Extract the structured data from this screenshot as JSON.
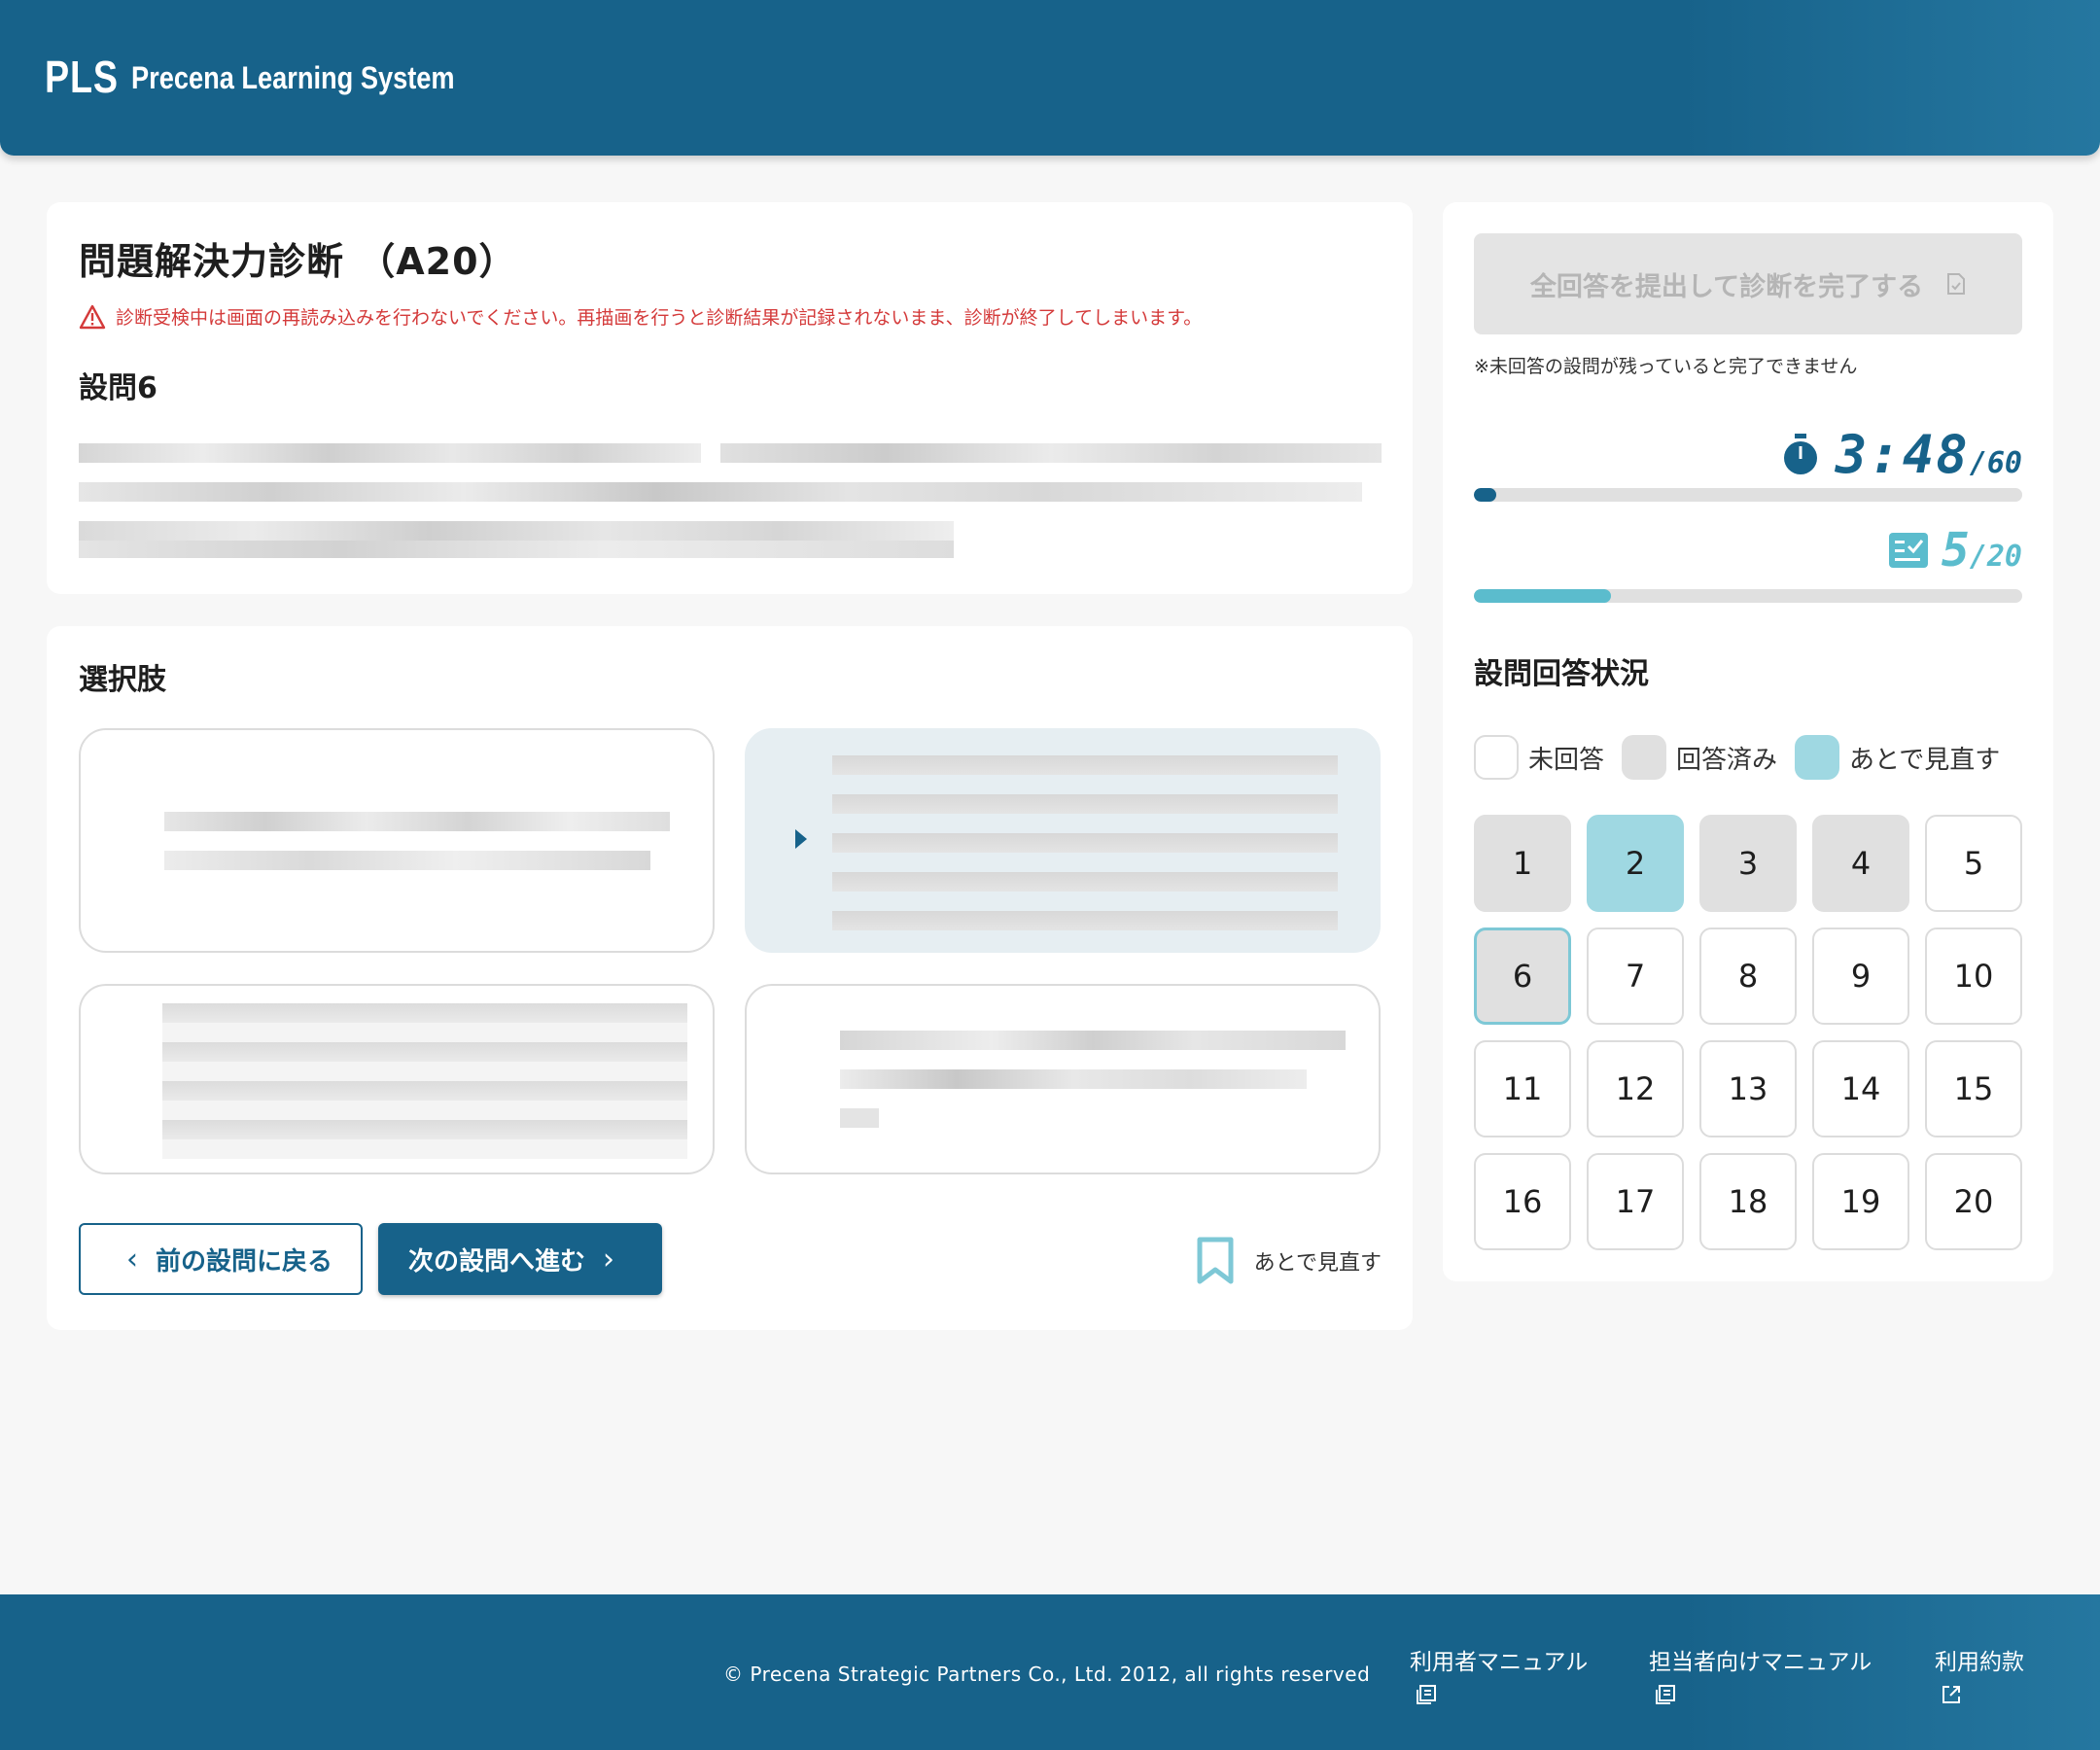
{
  "header": {
    "logo_mark": "PLS",
    "logo_text": "Precena Learning System"
  },
  "question_card": {
    "title": "問題解決力診断 （A20）",
    "warning": "診断受検中は画面の再読み込みを行わないでください。再描画を行うと診断結果が記録されないまま、診断が終了してしまいます。",
    "question_label": "設問6"
  },
  "options_card": {
    "section_label": "選択肢",
    "prev_button": "前の設問に戻る",
    "next_button": "次の設問へ進む",
    "review_later": "あとで見直す"
  },
  "sidebar": {
    "submit_button": "全回答を提出して診断を完了する",
    "submit_note": "※未回答の設問が残っていると完了できません",
    "timer_value": "3:48",
    "timer_total": "/60",
    "timer_progress": 0.04,
    "answered_count": "5",
    "answered_total": "/20",
    "answered_progress": 0.25,
    "status_title": "設問回答状況",
    "legend": {
      "unanswered": "未回答",
      "answered": "回答済み",
      "review": "あとで見直す"
    },
    "questions": [
      {
        "n": "1",
        "state": "answered"
      },
      {
        "n": "2",
        "state": "review"
      },
      {
        "n": "3",
        "state": "answered"
      },
      {
        "n": "4",
        "state": "answered"
      },
      {
        "n": "5",
        "state": "unanswered"
      },
      {
        "n": "6",
        "state": "current"
      },
      {
        "n": "7",
        "state": "unanswered"
      },
      {
        "n": "8",
        "state": "unanswered"
      },
      {
        "n": "9",
        "state": "unanswered"
      },
      {
        "n": "10",
        "state": "unanswered"
      },
      {
        "n": "11",
        "state": "unanswered"
      },
      {
        "n": "12",
        "state": "unanswered"
      },
      {
        "n": "13",
        "state": "unanswered"
      },
      {
        "n": "14",
        "state": "unanswered"
      },
      {
        "n": "15",
        "state": "unanswered"
      },
      {
        "n": "16",
        "state": "unanswered"
      },
      {
        "n": "17",
        "state": "unanswered"
      },
      {
        "n": "18",
        "state": "unanswered"
      },
      {
        "n": "19",
        "state": "unanswered"
      },
      {
        "n": "20",
        "state": "unanswered"
      }
    ]
  },
  "footer": {
    "copyright": "© Precena Strategic Partners Co., Ltd. 2012, all rights reserved",
    "links": [
      "利用者マニュアル",
      "担当者向けマニュアル",
      "利用約款"
    ]
  },
  "colors": {
    "primary": "#17628a",
    "accent": "#5bbccd",
    "review": "#9fd8e2",
    "warning": "#d43a3a"
  }
}
